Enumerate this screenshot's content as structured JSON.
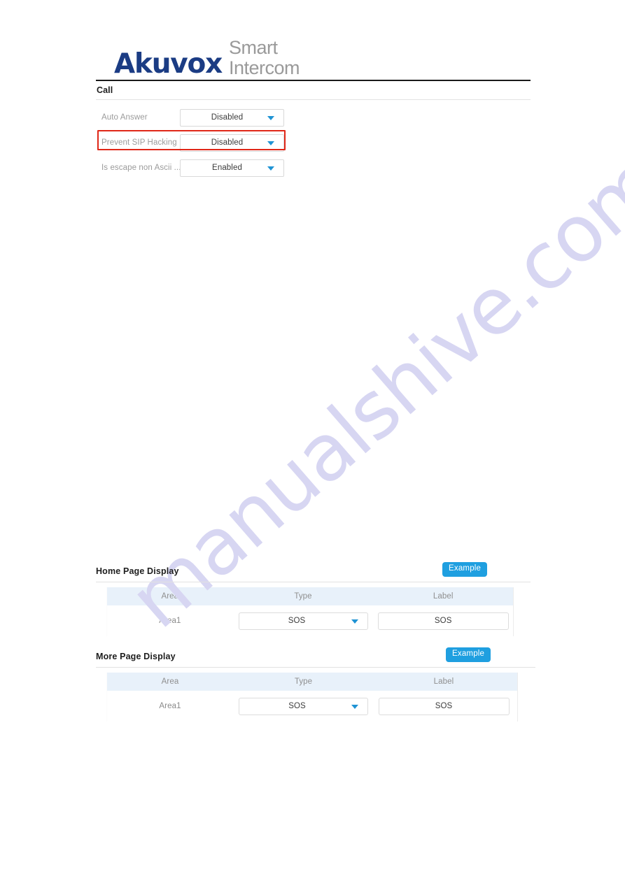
{
  "brand": {
    "name": "Akuvox",
    "tagline_line1": "Smart",
    "tagline_line2": "Intercom",
    "logo_color": "#1b3c84",
    "tagline_color": "#9a9a9a"
  },
  "watermark": {
    "text": "manualshive.com",
    "color": "#d7d6f2"
  },
  "call_section": {
    "title": "Call",
    "highlight_color": "#e02718",
    "fields": [
      {
        "label": "Auto Answer",
        "value": "Disabled"
      },
      {
        "label": "Prevent SIP Hacking",
        "value": "Disabled",
        "highlighted": true
      },
      {
        "label": "Is escape non Ascii ...",
        "value": "Enabled"
      }
    ]
  },
  "display_sections": [
    {
      "title": "Home Page Display",
      "example_label": "Example",
      "columns": [
        "Area",
        "Type",
        "Label"
      ],
      "rows": [
        {
          "area": "Area1",
          "type": "SOS",
          "label": "SOS"
        }
      ]
    },
    {
      "title": "More Page Display",
      "example_label": "Example",
      "columns": [
        "Area",
        "Type",
        "Label"
      ],
      "rows": [
        {
          "area": "Area1",
          "type": "SOS",
          "label": "SOS"
        }
      ]
    }
  ],
  "colors": {
    "accent_blue": "#1f9fe0",
    "caret_blue": "#1f93d4",
    "table_header_bg": "#e8f1fa"
  }
}
